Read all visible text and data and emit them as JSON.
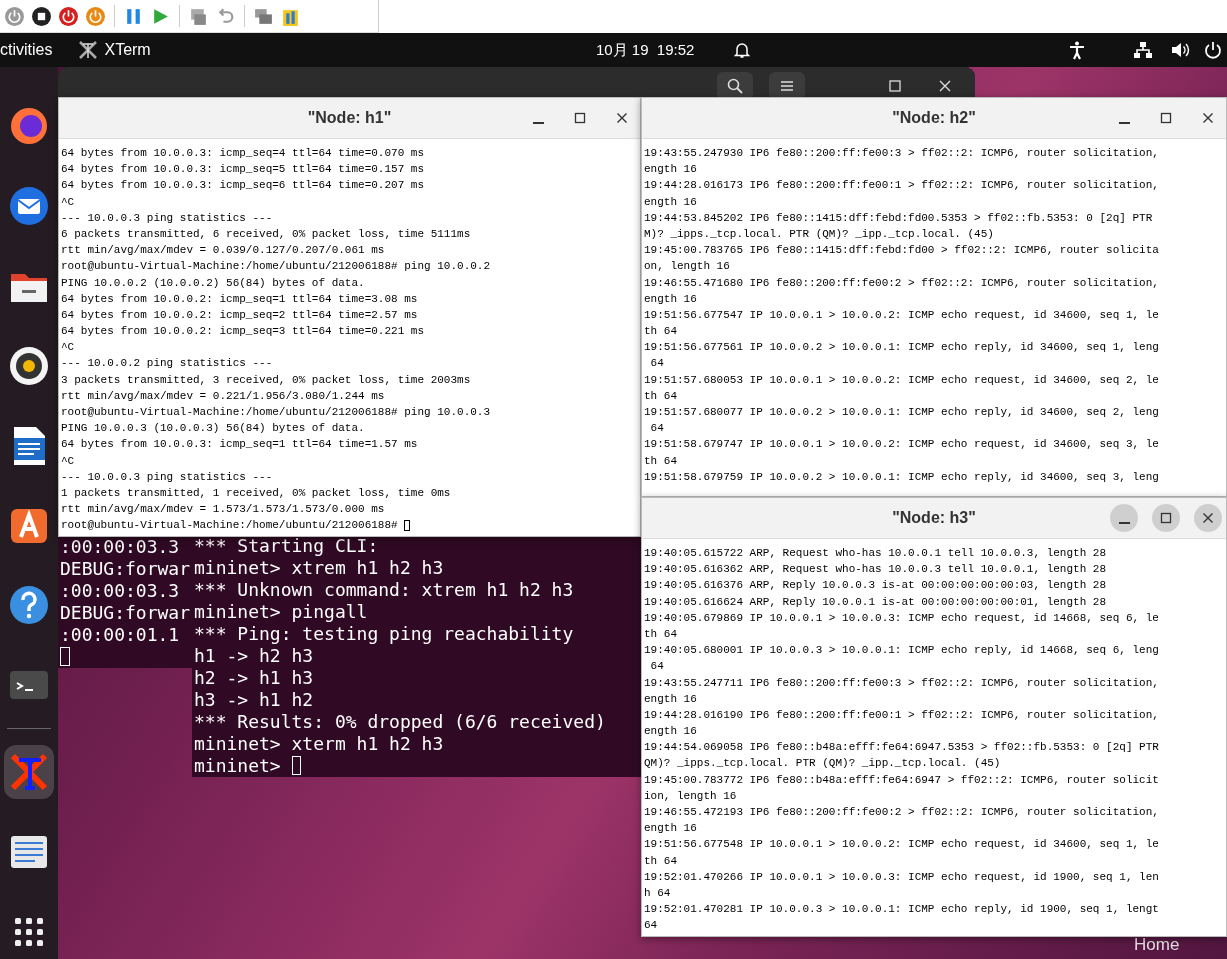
{
  "top_bar": {
    "activities": "ctivities",
    "app_name": "XTerm",
    "clock": "10月 19  19:52"
  },
  "dock": {
    "items": [
      {
        "kind": "browser",
        "selected": false
      },
      {
        "kind": "mail",
        "selected": false
      },
      {
        "kind": "files",
        "selected": false
      },
      {
        "kind": "music",
        "selected": false
      },
      {
        "kind": "writer",
        "selected": false
      },
      {
        "kind": "store",
        "selected": false
      },
      {
        "kind": "help",
        "selected": false
      },
      {
        "kind": "terminal",
        "selected": false
      },
      {
        "kind": "xterm",
        "selected": true
      },
      {
        "kind": "editor",
        "selected": false
      },
      {
        "kind": "apps",
        "selected": false
      }
    ]
  },
  "desktop": {
    "icon_label": "Home"
  },
  "pox_terminal": {
    "lines": [
      ":00:00:03.3",
      "DEBUG:forwar",
      ":00:00:03.3",
      "DEBUG:forwar",
      ":00:00:01.1"
    ]
  },
  "mininet_terminal": {
    "lines": [
      "*** Starting CLI:",
      "mininet> xtrem h1 h2 h3",
      "*** Unknown command: xtrem h1 h2 h3",
      "mininet> pingall",
      "*** Ping: testing ping reachability",
      "h1 -> h2 h3",
      "h2 -> h1 h3",
      "h3 -> h1 h2",
      "*** Results: 0% dropped (6/6 received)",
      "mininet> xterm h1 h2 h3"
    ],
    "prompt": "mininet>"
  },
  "xterm_windows": [
    {
      "title": "\"Node: h1\"",
      "active": false,
      "lines": [
        "64 bytes from 10.0.0.3: icmp_seq=4 ttl=64 time=0.070 ms",
        "64 bytes from 10.0.0.3: icmp_seq=5 ttl=64 time=0.157 ms",
        "64 bytes from 10.0.0.3: icmp_seq=6 ttl=64 time=0.207 ms",
        "^C",
        "--- 10.0.0.3 ping statistics ---",
        "6 packets transmitted, 6 received, 0% packet loss, time 5111ms",
        "rtt min/avg/max/mdev = 0.039/0.127/0.207/0.061 ms",
        "root@ubuntu-Virtual-Machine:/home/ubuntu/212006188# ping 10.0.0.2",
        "PING 10.0.0.2 (10.0.0.2) 56(84) bytes of data.",
        "64 bytes from 10.0.0.2: icmp_seq=1 ttl=64 time=3.08 ms",
        "64 bytes from 10.0.0.2: icmp_seq=2 ttl=64 time=2.57 ms",
        "64 bytes from 10.0.0.2: icmp_seq=3 ttl=64 time=0.221 ms",
        "^C",
        "--- 10.0.0.2 ping statistics ---",
        "3 packets transmitted, 3 received, 0% packet loss, time 2003ms",
        "rtt min/avg/max/mdev = 0.221/1.956/3.080/1.244 ms",
        "root@ubuntu-Virtual-Machine:/home/ubuntu/212006188# ping 10.0.0.3",
        "PING 10.0.0.3 (10.0.0.3) 56(84) bytes of data.",
        "64 bytes from 10.0.0.3: icmp_seq=1 ttl=64 time=1.57 ms",
        "^C",
        "--- 10.0.0.3 ping statistics ---",
        "1 packets transmitted, 1 received, 0% packet loss, time 0ms",
        "rtt min/avg/max/mdev = 1.573/1.573/1.573/0.000 ms"
      ],
      "prompt": "root@ubuntu-Virtual-Machine:/home/ubuntu/212006188#"
    },
    {
      "title": "\"Node: h2\"",
      "active": false,
      "lines": [
        "19:43:55.247930 IP6 fe80::200:ff:fe00:3 > ff02::2: ICMP6, router solicitation,",
        "ength 16",
        "19:44:28.016173 IP6 fe80::200:ff:fe00:1 > ff02::2: ICMP6, router solicitation,",
        "ength 16",
        "19:44:53.845202 IP6 fe80::1415:dff:febd:fd00.5353 > ff02::fb.5353: 0 [2q] PTR",
        "M)? _ipps._tcp.local. PTR (QM)? _ipp._tcp.local. (45)",
        "19:45:00.783765 IP6 fe80::1415:dff:febd:fd00 > ff02::2: ICMP6, router solicita",
        "on, length 16",
        "19:46:55.471680 IP6 fe80::200:ff:fe00:2 > ff02::2: ICMP6, router solicitation,",
        "ength 16",
        "19:51:56.677547 IP 10.0.0.1 > 10.0.0.2: ICMP echo request, id 34600, seq 1, le",
        "th 64",
        "19:51:56.677561 IP 10.0.0.2 > 10.0.0.1: ICMP echo reply, id 34600, seq 1, leng",
        " 64",
        "19:51:57.680053 IP 10.0.0.1 > 10.0.0.2: ICMP echo request, id 34600, seq 2, le",
        "th 64",
        "19:51:57.680077 IP 10.0.0.2 > 10.0.0.1: ICMP echo reply, id 34600, seq 2, leng",
        " 64",
        "19:51:58.679747 IP 10.0.0.1 > 10.0.0.2: ICMP echo request, id 34600, seq 3, le",
        "th 64",
        "19:51:58.679759 IP 10.0.0.2 > 10.0.0.1: ICMP echo reply, id 34600, seq 3, leng"
      ]
    },
    {
      "title": "\"Node: h3\"",
      "active": true,
      "lines": [
        "19:40:05.615722 ARP, Request who-has 10.0.0.1 tell 10.0.0.3, length 28",
        "19:40:05.616362 ARP, Request who-has 10.0.0.3 tell 10.0.0.1, length 28",
        "19:40:05.616376 ARP, Reply 10.0.0.3 is-at 00:00:00:00:00:03, length 28",
        "19:40:05.616624 ARP, Reply 10.0.0.1 is-at 00:00:00:00:00:01, length 28",
        "19:40:05.679869 IP 10.0.0.1 > 10.0.0.3: ICMP echo request, id 14668, seq 6, le",
        "th 64",
        "19:40:05.680001 IP 10.0.0.3 > 10.0.0.1: ICMP echo reply, id 14668, seq 6, leng",
        " 64",
        "19:43:55.247711 IP6 fe80::200:ff:fe00:3 > ff02::2: ICMP6, router solicitation,",
        "ength 16",
        "19:44:28.016190 IP6 fe80::200:ff:fe00:1 > ff02::2: ICMP6, router solicitation,",
        "ength 16",
        "19:44:54.069058 IP6 fe80::b48a:efff:fe64:6947.5353 > ff02::fb.5353: 0 [2q] PTR",
        "QM)? _ipps._tcp.local. PTR (QM)? _ipp._tcp.local. (45)",
        "19:45:00.783772 IP6 fe80::b48a:efff:fe64:6947 > ff02::2: ICMP6, router solicit",
        "ion, length 16",
        "19:46:55.472193 IP6 fe80::200:ff:fe00:2 > ff02::2: ICMP6, router solicitation,",
        "ength 16",
        "19:51:56.677548 IP 10.0.0.1 > 10.0.0.2: ICMP echo request, id 34600, seq 1, le",
        "th 64",
        "19:52:01.470266 IP 10.0.0.1 > 10.0.0.3: ICMP echo request, id 1900, seq 1, len",
        "h 64",
        "19:52:01.470281 IP 10.0.0.3 > 10.0.0.1: ICMP echo reply, id 1900, seq 1, lengt",
        "64"
      ]
    }
  ]
}
